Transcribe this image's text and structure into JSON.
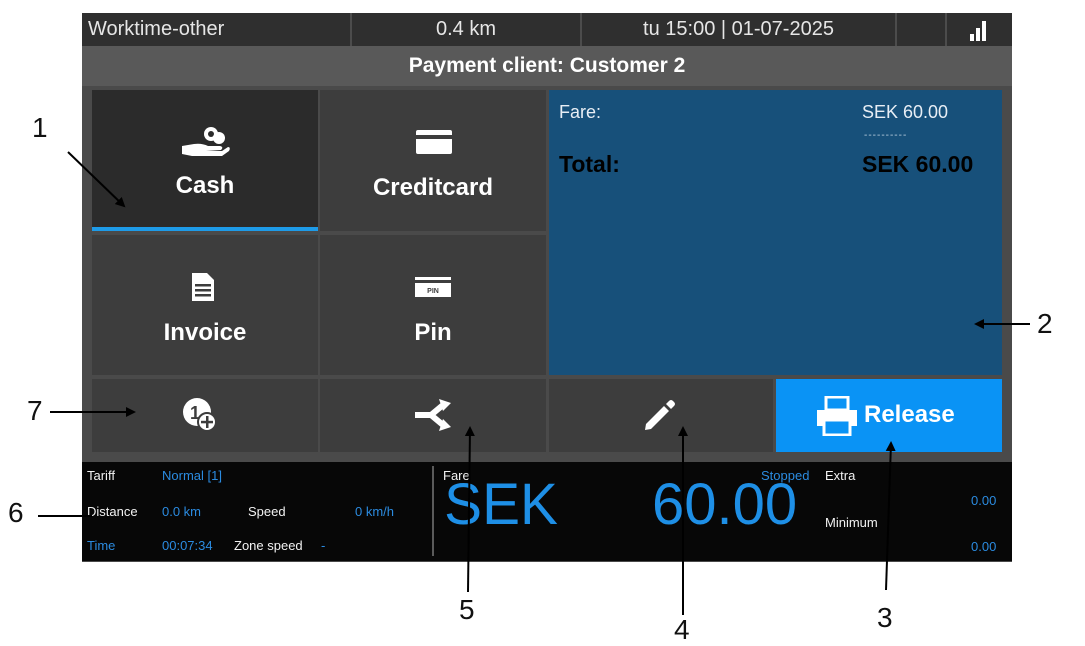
{
  "status_bar": {
    "mode": "Worktime-other",
    "distance": "0.4 km",
    "datetime": "tu 15:00 | 01-07-2025",
    "signal_icon": "signal-bars-icon"
  },
  "header": {
    "title": "Payment client: Customer 2"
  },
  "payment_methods": [
    {
      "label": "Cash",
      "icon": "cash-hand-icon",
      "selected": true
    },
    {
      "label": "Creditcard",
      "icon": "credit-card-icon",
      "selected": false
    },
    {
      "label": "Invoice",
      "icon": "invoice-document-icon",
      "selected": false
    },
    {
      "label": "Pin",
      "icon": "pin-card-icon",
      "selected": false
    }
  ],
  "summary": {
    "fare_label": "Fare:",
    "fare_value": "SEK 60.00",
    "separator": "----------",
    "total_label": "Total:",
    "total_value": "SEK 60.00"
  },
  "actions": {
    "add_icon": "add-extra-icon",
    "split_icon": "split-fare-icon",
    "edit_icon": "pencil-icon",
    "release_label": "Release",
    "release_icon": "printer-icon"
  },
  "meter": {
    "tariff_label": "Tariff",
    "tariff_value": "Normal [1]",
    "distance_label": "Distance",
    "distance_value": "0.0 km",
    "speed_label": "Speed",
    "speed_value": "0 km/h",
    "time_label": "Time",
    "time_value": "00:07:34",
    "zone_speed_label": "Zone speed",
    "zone_speed_value": "-",
    "fare_label": "Fare",
    "state": "Stopped",
    "currency": "SEK",
    "amount": "60.00",
    "extra_label": "Extra",
    "extra_value": "0.00",
    "minimum_label": "Minimum",
    "minimum_value": "0.00"
  },
  "callouts": [
    "1",
    "2",
    "3",
    "4",
    "5",
    "6",
    "7"
  ],
  "colors": {
    "accent_blue": "#0a93f5",
    "panel_blue": "#17507a",
    "meter_blue": "#1e8fe6",
    "tile_gray": "#3d3d3d"
  }
}
